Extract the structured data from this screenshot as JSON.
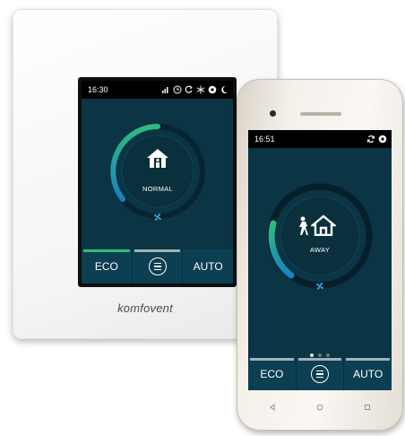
{
  "panel": {
    "time": "16:30",
    "status_icons": [
      "fan-icon",
      "clock-icon",
      "moon-arc-icon",
      "snowflake-icon",
      "gear-icon",
      "moon-icon"
    ],
    "mode": "NORMAL",
    "tabs": {
      "left": "ECO",
      "right": "AUTO"
    },
    "brand": "komfovent"
  },
  "phone": {
    "time": "16:51",
    "status_icons": [
      "sync-icon",
      "gear-icon"
    ],
    "mode": "AWAY",
    "tabs": {
      "left": "ECO",
      "right": "AUTO"
    },
    "page_dots": {
      "count": 3,
      "active": 0
    },
    "nav_icons": [
      "back-icon",
      "home-icon",
      "recents-icon"
    ]
  },
  "colors": {
    "screen_bg": "#0b3444",
    "arc_start": "#2dbd7e",
    "arc_end": "#1d7fc0",
    "active_tab": "#2dbd7e"
  }
}
